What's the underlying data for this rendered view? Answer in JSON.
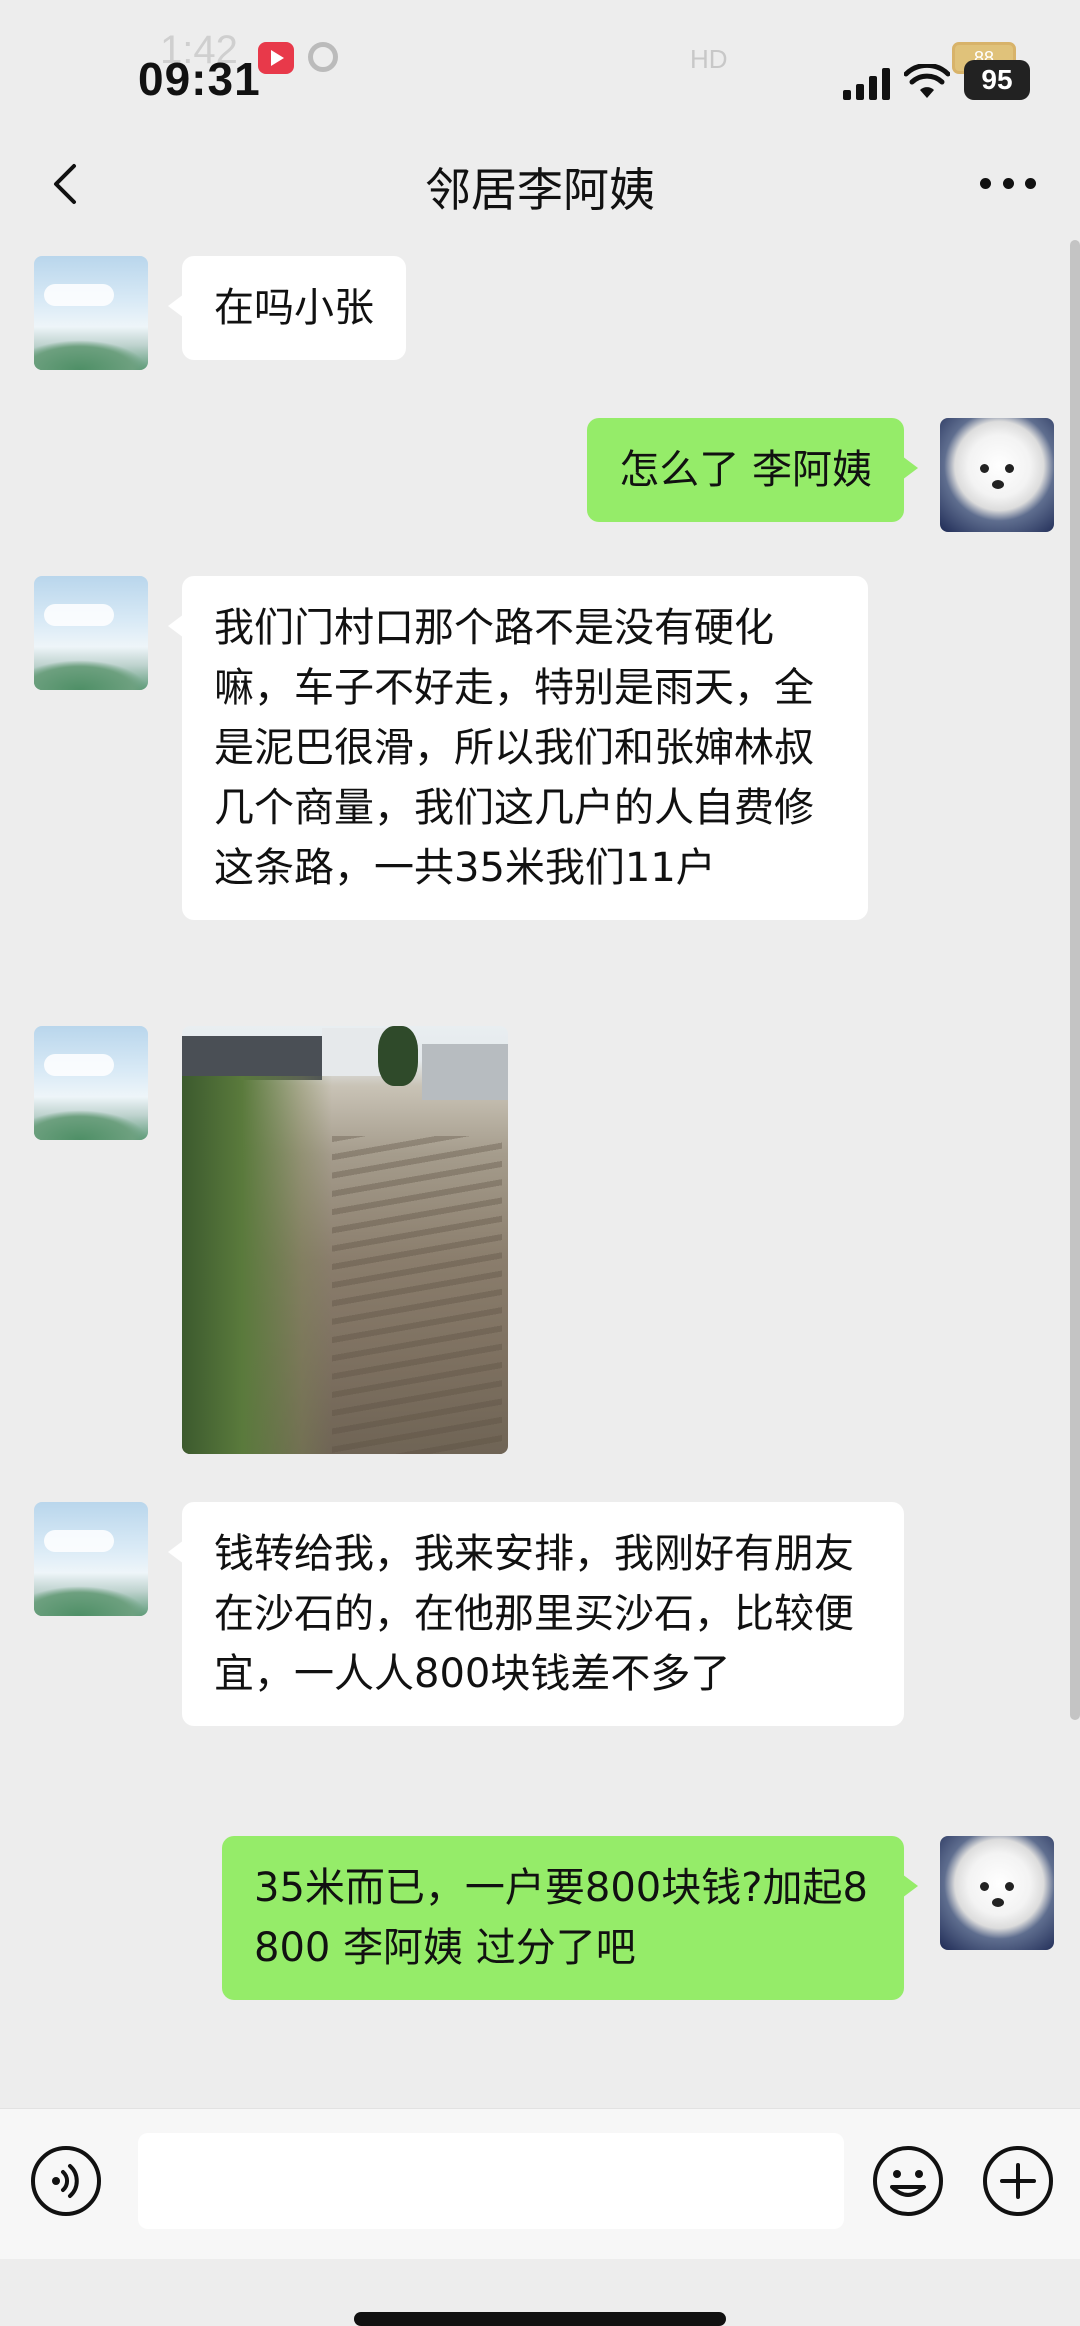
{
  "status_bar": {
    "time": "09:31",
    "time_ghost": "1:42",
    "battery": "95",
    "battery_ghost": "88",
    "ghost_icons": "HD"
  },
  "nav": {
    "title": "邻居李阿姨"
  },
  "messages": [
    {
      "direction": "in",
      "type": "text",
      "text": "在吗小张"
    },
    {
      "direction": "out",
      "type": "text",
      "text": "怎么了 李阿姨"
    },
    {
      "direction": "in",
      "type": "text",
      "text": "我们门村口那个路不是没有硬化嘛，车子不好走，特别是雨天，全是泥巴很滑，所以我们和张婶林叔几个商量，我们这几户的人自费修这条路，一共35米我们11户"
    },
    {
      "direction": "in",
      "type": "image",
      "text": ""
    },
    {
      "direction": "in",
      "type": "text",
      "text": "钱转给我，我来安排，我刚好有朋友在沙石的，在他那里买沙石，比较便宜，一人人800块钱差不多了"
    },
    {
      "direction": "out",
      "type": "text",
      "text": "35米而已，一户要800块钱?加起8800 李阿姨 过分了吧"
    }
  ],
  "input_bar": {
    "placeholder": ""
  },
  "colors": {
    "background": "#ededed",
    "outgoing_bubble": "#95ec69",
    "incoming_bubble": "#ffffff"
  },
  "icons": {
    "back": "chevron-left-icon",
    "more": "more-dots-icon",
    "voice": "voice-icon",
    "emoji": "emoji-icon",
    "plus": "plus-icon"
  }
}
